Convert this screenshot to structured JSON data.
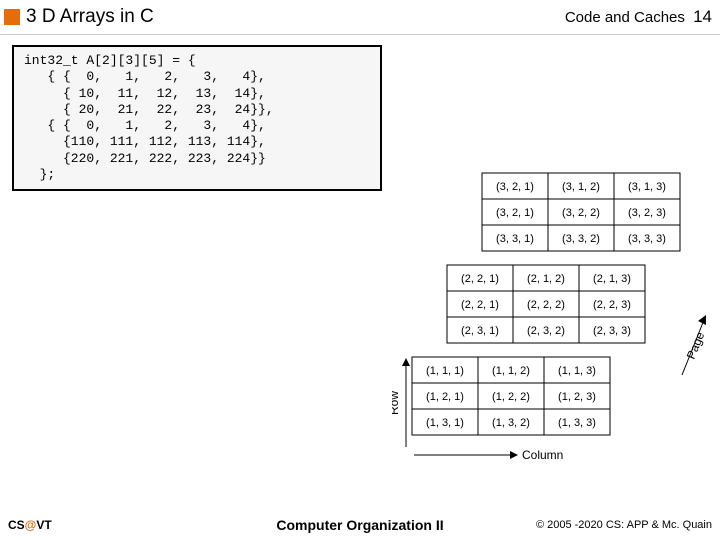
{
  "header": {
    "title": "3 D Arrays in C",
    "topic": "Code and Caches",
    "page": "14"
  },
  "code": {
    "text": "int32_t A[2][3][5] = {\n   { {  0,   1,   2,   3,   4},\n     { 10,  11,  12,  13,  14},\n     { 20,  21,  22,  23,  24}},\n   { {  0,   1,   2,   3,   4},\n     {110, 111, 112, 113, 114},\n     {220, 221, 222, 223, 224}}\n  };"
  },
  "diagram": {
    "axes": {
      "row": "Row",
      "column": "Column",
      "page": "Page"
    },
    "layers": [
      {
        "grid": [
          [
            "(3, 2, 1)",
            "(3, 1, 2)",
            "(3, 1, 3)"
          ],
          [
            "(3, 2, 1)",
            "(3, 2, 2)",
            "(3, 2, 3)"
          ],
          [
            "(3, 3, 1)",
            "(3, 3, 2)",
            "(3, 3, 3)"
          ]
        ]
      },
      {
        "grid": [
          [
            "(2, 2, 1)",
            "(2, 1, 2)",
            "(2, 1, 3)"
          ],
          [
            "(2, 2, 1)",
            "(2, 2, 2)",
            "(2, 2, 3)"
          ],
          [
            "(2, 3, 1)",
            "(2, 3, 2)",
            "(2, 3, 3)"
          ]
        ]
      },
      {
        "grid": [
          [
            "(1, 1, 1)",
            "(1, 1, 2)",
            "(1, 1, 3)"
          ],
          [
            "(1, 2, 1)",
            "(1, 2, 2)",
            "(1, 2, 3)"
          ],
          [
            "(1, 3, 1)",
            "(1, 3, 2)",
            "(1, 3, 3)"
          ]
        ]
      }
    ]
  },
  "footer": {
    "left_pre": "CS",
    "left_at": "@",
    "left_post": "VT",
    "center": "Computer Organization II",
    "right": "© 2005 -2020 CS: APP & Mc. Quain"
  }
}
